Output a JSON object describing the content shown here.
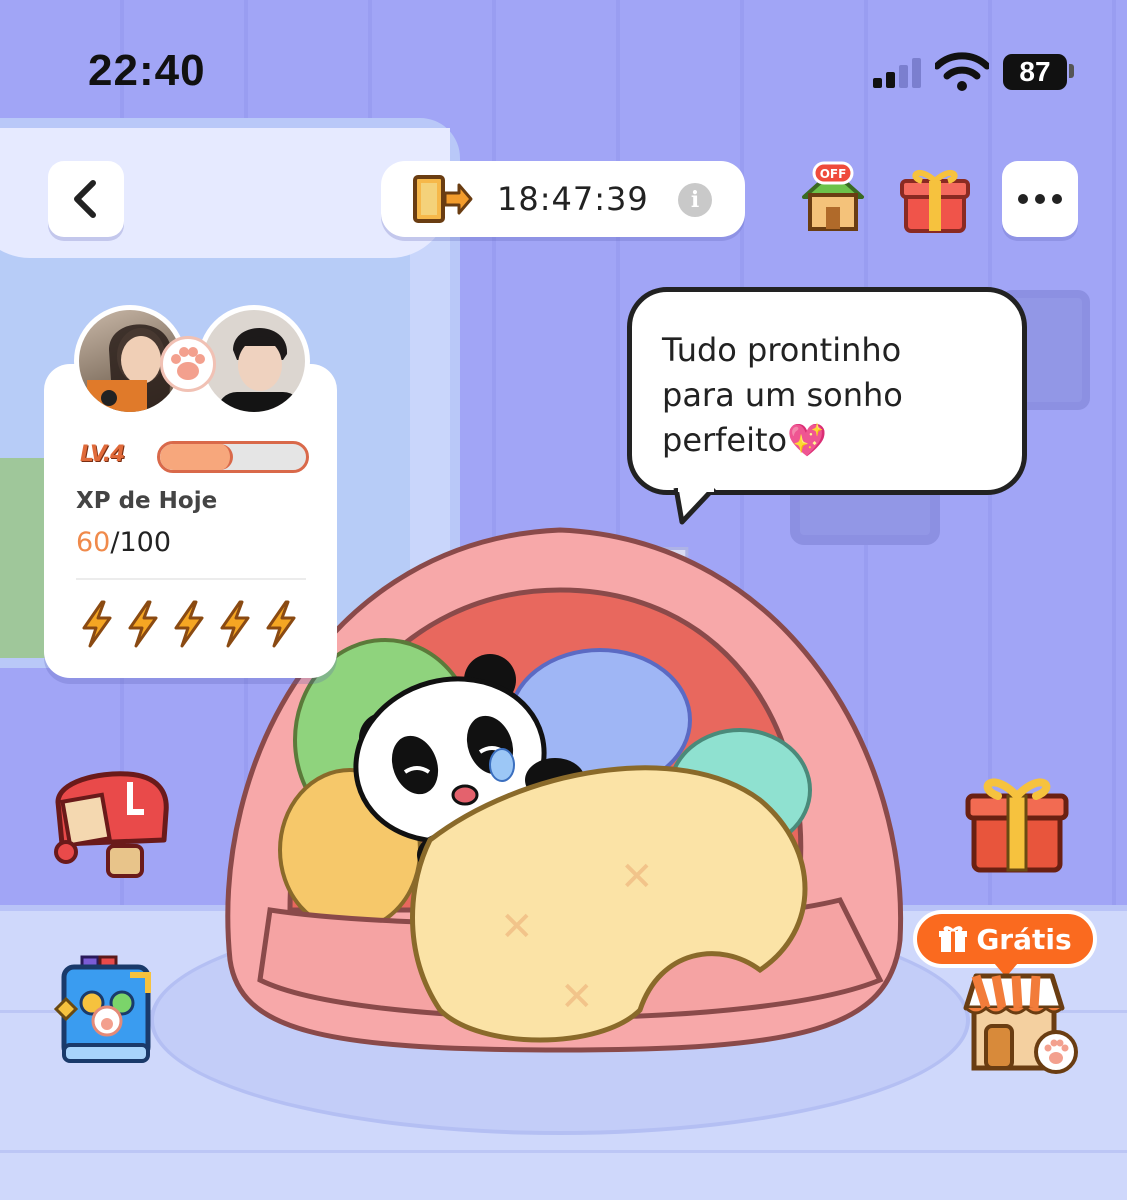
{
  "status_bar": {
    "time": "22:40",
    "battery": "87"
  },
  "top_bar": {
    "timer": "18:47:39"
  },
  "xp_card": {
    "level_label": "LV.4",
    "xp_title": "XP de Hoje",
    "xp_current": "60",
    "xp_total": "/100",
    "xp_progress_fraction": 0.5,
    "energy_count": 5
  },
  "speech": {
    "line1": "Tudo prontinho",
    "line2": "para um sonho",
    "line3": "perfeito💖"
  },
  "shop": {
    "free_label": "Grátis"
  },
  "colors": {
    "accent_orange": "#fa6a1f",
    "wall": "#a1a5f6",
    "xp_fill": "#f7a77c"
  },
  "icons": [
    "back-chevron-icon",
    "exit-door-icon",
    "info-icon",
    "house-off-icon",
    "gift-icon",
    "more-dots-icon",
    "mailbox-icon",
    "album-book-icon",
    "gift-box-icon",
    "pet-shop-icon",
    "paw-icon",
    "lightning-icon"
  ]
}
